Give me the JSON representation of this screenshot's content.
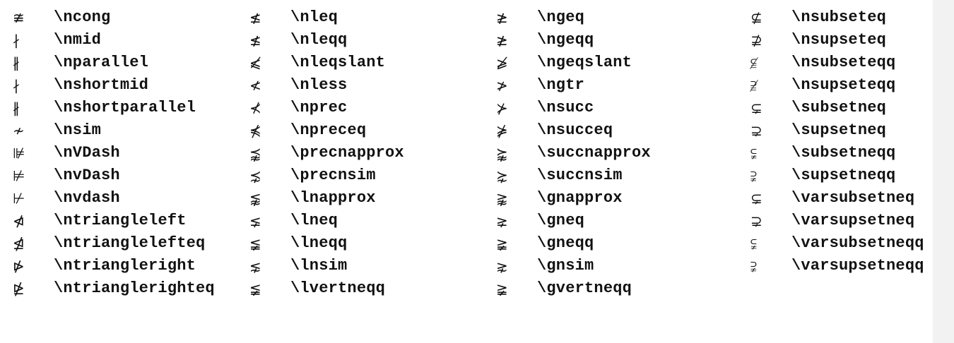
{
  "columns": [
    [
      {
        "symbol": "≇",
        "command": "\\ncong"
      },
      {
        "symbol": "∤",
        "command": "\\nmid"
      },
      {
        "symbol": "∦",
        "command": "\\nparallel"
      },
      {
        "symbol": "∤",
        "command": "\\nshortmid"
      },
      {
        "symbol": "∦",
        "command": "\\nshortparallel"
      },
      {
        "symbol": "≁",
        "command": "\\nsim"
      },
      {
        "symbol": "⊯",
        "command": "\\nVDash"
      },
      {
        "symbol": "⊭",
        "command": "\\nvDash"
      },
      {
        "symbol": "⊬",
        "command": "\\nvdash"
      },
      {
        "symbol": "⋪",
        "command": "\\ntriangleleft"
      },
      {
        "symbol": "⋬",
        "command": "\\ntrianglelefteq"
      },
      {
        "symbol": "⋫",
        "command": "\\ntriangleright"
      },
      {
        "symbol": "⋭",
        "command": "\\ntrianglerighteq"
      }
    ],
    [
      {
        "symbol": "≰",
        "command": "\\nleq"
      },
      {
        "symbol": "≰",
        "command": "\\nleqq"
      },
      {
        "symbol": "⩽̸",
        "command": "\\nleqslant"
      },
      {
        "symbol": "≮",
        "command": "\\nless"
      },
      {
        "symbol": "⊀",
        "command": "\\nprec"
      },
      {
        "symbol": "⋠",
        "command": "\\npreceq"
      },
      {
        "symbol": "⪹",
        "command": "\\precnapprox"
      },
      {
        "symbol": "⋨",
        "command": "\\precnsim"
      },
      {
        "symbol": "⪉",
        "command": "\\lnapprox"
      },
      {
        "symbol": "⪇",
        "command": "\\lneq"
      },
      {
        "symbol": "≨",
        "command": "\\lneqq"
      },
      {
        "symbol": "⋦",
        "command": "\\lnsim"
      },
      {
        "symbol": "≨",
        "command": "\\lvertneqq"
      }
    ],
    [
      {
        "symbol": "≱",
        "command": "\\ngeq"
      },
      {
        "symbol": "≱",
        "command": "\\ngeqq"
      },
      {
        "symbol": "⩾̸",
        "command": "\\ngeqslant"
      },
      {
        "symbol": "≯",
        "command": "\\ngtr"
      },
      {
        "symbol": "⊁",
        "command": "\\nsucc"
      },
      {
        "symbol": "⋡",
        "command": "\\nsucceq"
      },
      {
        "symbol": "⪺",
        "command": "\\succnapprox"
      },
      {
        "symbol": "⋩",
        "command": "\\succnsim"
      },
      {
        "symbol": "⪊",
        "command": "\\gnapprox"
      },
      {
        "symbol": "⪈",
        "command": "\\gneq"
      },
      {
        "symbol": "≩",
        "command": "\\gneqq"
      },
      {
        "symbol": "⋧",
        "command": "\\gnsim"
      },
      {
        "symbol": "≩",
        "command": "\\gvertneqq"
      }
    ],
    [
      {
        "symbol": "⊈",
        "command": "\\nsubseteq"
      },
      {
        "symbol": "⊉",
        "command": "\\nsupseteq"
      },
      {
        "symbol": "⫅̸",
        "command": "\\nsubseteqq"
      },
      {
        "symbol": "⫆̸",
        "command": "\\nsupseteqq"
      },
      {
        "symbol": "⊊",
        "command": "\\subsetneq"
      },
      {
        "symbol": "⊋",
        "command": "\\supsetneq"
      },
      {
        "symbol": "⫋",
        "command": "\\subsetneqq"
      },
      {
        "symbol": "⫌",
        "command": "\\supsetneqq"
      },
      {
        "symbol": "⊊",
        "command": "\\varsubsetneq"
      },
      {
        "symbol": "⊋",
        "command": "\\varsupsetneq"
      },
      {
        "symbol": "⫋",
        "command": "\\varsubsetneqq"
      },
      {
        "symbol": "⫌",
        "command": "\\varsupsetneqq"
      }
    ]
  ]
}
